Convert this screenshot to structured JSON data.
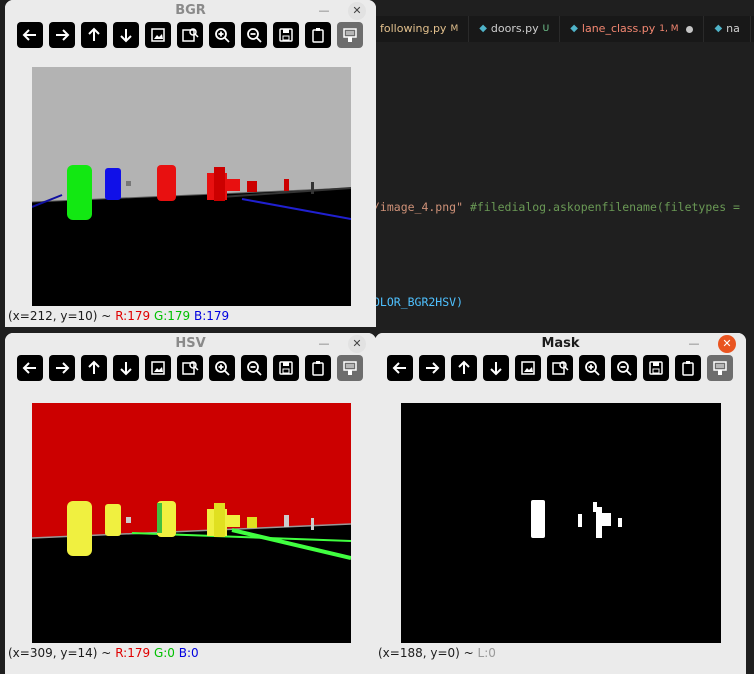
{
  "editor": {
    "tabs": [
      {
        "label": "following.py",
        "badge": "M"
      },
      {
        "label": "doors.py",
        "badge": "U"
      },
      {
        "label": "lane_class.py",
        "badge": "1, M"
      },
      {
        "label": "na",
        "badge": ""
      }
    ],
    "code_line1_str": "/image_4.png\"",
    "code_line1_comment": " #filedialog.askopenfilename(filetypes =",
    "code_line2": "OLOR_BGR2HSV)"
  },
  "windows": {
    "bgr": {
      "title": "BGR",
      "status_pos": "(x=212, y=10) ~",
      "status_r": "R:179",
      "status_g": "G:179",
      "status_b": "B:179"
    },
    "hsv": {
      "title": "HSV",
      "status_pos": "(x=309, y=14) ~",
      "status_r": "R:179",
      "status_g": "G:0",
      "status_b": "B:0"
    },
    "mask": {
      "title": "Mask",
      "status_pos": "(x=188, y=0) ~",
      "status_l": "L:0"
    }
  },
  "toolbar_icons": [
    "arrow-left-icon",
    "arrow-right-icon",
    "arrow-up-icon",
    "arrow-down-icon",
    "image-icon",
    "image-search-icon",
    "zoom-in-icon",
    "zoom-out-icon",
    "save-icon",
    "clipboard-icon",
    "properties-icon"
  ],
  "colors": {
    "sky": "#b3b3b3",
    "red_bg": "#cc0000",
    "window_bg": "#ebebeb",
    "close_active": "#e95420"
  }
}
